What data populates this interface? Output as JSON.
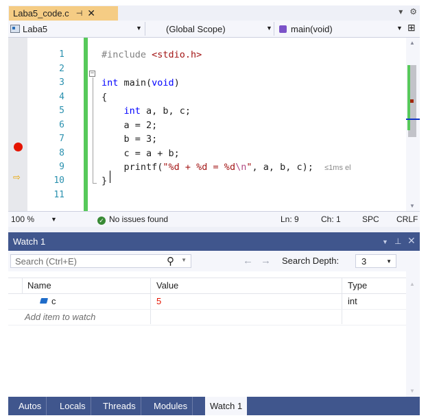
{
  "editor_tab": {
    "filename": "Laba5_code.c",
    "pin_icon": "pin-icon",
    "close_glyph": "✕"
  },
  "tab_strip_controls": {
    "dropdown_glyph": "▾",
    "settings_glyph": "⚙"
  },
  "nav_bar": {
    "project": "Laba5",
    "scope": "(Global Scope)",
    "function": "main(void)",
    "split_glyph": "⊞"
  },
  "code": {
    "line_numbers": [
      "1",
      "2",
      "3",
      "4",
      "5",
      "6",
      "7",
      "8",
      "9",
      "10",
      "11"
    ],
    "lines": [
      {
        "n": 1,
        "text": "#include <stdio.h>"
      },
      {
        "n": 2,
        "text": ""
      },
      {
        "n": 3,
        "text": "int main(void)"
      },
      {
        "n": 4,
        "text": "{"
      },
      {
        "n": 5,
        "text": "    int a, b, c;"
      },
      {
        "n": 6,
        "text": "    a = 2;"
      },
      {
        "n": 7,
        "text": "    b = 3;"
      },
      {
        "n": 8,
        "text": "    c = a + b;"
      },
      {
        "n": 9,
        "text": "    printf(\"%d + %d = %d\\n\", a, b, c);"
      },
      {
        "n": 10,
        "text": "}"
      },
      {
        "n": 11,
        "text": ""
      }
    ],
    "breakpoint_line": 7,
    "current_line": 9,
    "perf_hint": "≤1ms el",
    "fold_glyph": "⊟"
  },
  "status_bar": {
    "zoom": "100 %",
    "issues": "No issues found",
    "line": "Ln: 9",
    "col": "Ch: 1",
    "whitespace": "SPC",
    "line_ending": "CRLF"
  },
  "watch": {
    "title": "Watch 1",
    "search_placeholder": "Search (Ctrl+E)",
    "search_depth_label": "Search Depth:",
    "search_depth_value": "3",
    "columns": {
      "name": "Name",
      "value": "Value",
      "type": "Type"
    },
    "rows": [
      {
        "name": "c",
        "value": "5",
        "type": "int"
      }
    ],
    "add_item_placeholder": "Add item to watch"
  },
  "bottom_tabs": [
    "Autos",
    "Locals",
    "Threads",
    "Modules",
    "Watch 1"
  ],
  "active_bottom_tab": "Watch 1",
  "colors": {
    "tab_active": "#f5cc84",
    "breakpoint": "#e51400",
    "toolwindow_title": "#40568d",
    "keyword": "#0000ff",
    "string": "#a31515",
    "changed_value": "#e51400"
  }
}
